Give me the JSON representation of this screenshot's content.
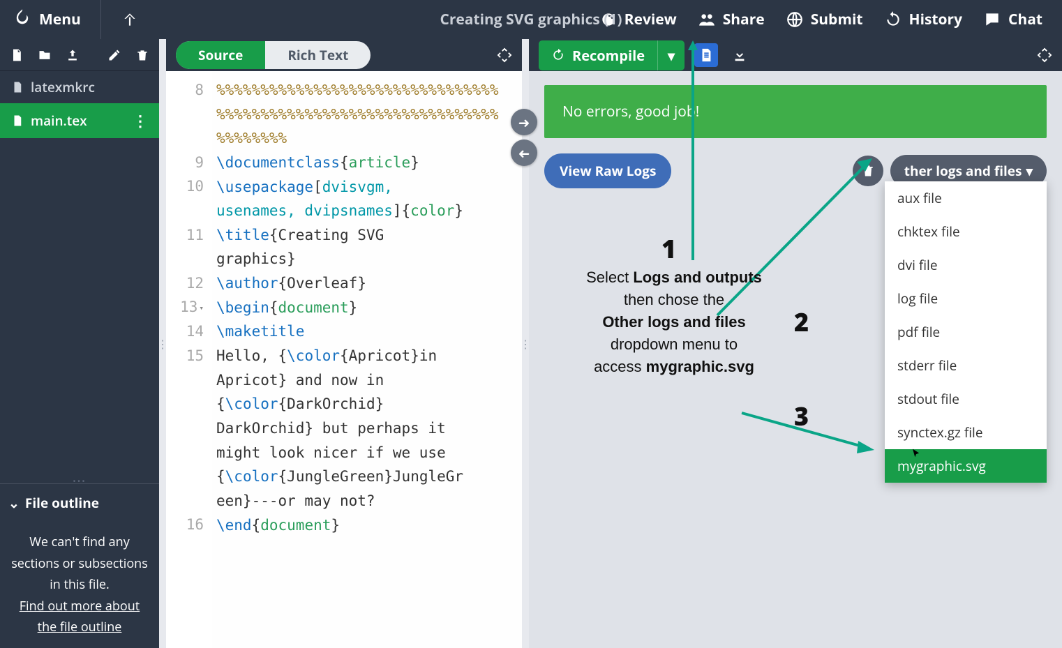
{
  "topbar": {
    "menu": "Menu",
    "title": "Creating SVG graphics (1)",
    "review": "Review",
    "share": "Share",
    "submit": "Submit",
    "history": "History",
    "chat": "Chat"
  },
  "files": {
    "f0": "latexmkrc",
    "f1": "main.tex"
  },
  "outline": {
    "head": "File outline",
    "body1": "We can't find any sections or subsections in this file.",
    "link": "Find out more about the file outline"
  },
  "editor": {
    "source": "Source",
    "rich": "Rich Text",
    "lines": {
      "8": "8",
      "9": "9",
      "10": "10",
      "11": "11",
      "12": "12",
      "13": "13",
      "14": "14",
      "15": "15",
      "16": "16"
    },
    "code": {
      "pct1": "%%%%%%%%%%%%%%%%%%%%%%%%%%%%%%%%",
      "pct2": "%%%%%%%%%%%%%%%%%%%%%%%%%%%%%%%%",
      "pct3": "%%%%%%%%",
      "dc_cmd": "\\documentclass",
      "dc_arg": "article",
      "up_cmd": "\\usepackage",
      "up_opt1": "dvisvgm,",
      "up_opt2": "usenames, dvipsnames",
      "up_arg": "color",
      "ti_cmd": "\\title",
      "ti_arg": "Creating SVG graphics",
      "au_cmd": "\\author",
      "au_arg": "Overleaf",
      "bg_cmd": "\\begin",
      "bg_arg": "document",
      "mk_cmd": "\\maketitle",
      "body1": "Hello, {",
      "col_cmd": "\\color",
      "col1": "Apricot",
      "body2": "in Apricot} and now in {",
      "col2": "DarkOrchid",
      "body3": "DarkOrchid} but perhaps it might look nicer if we use {",
      "col3": "JungleGreen",
      "body4": "JungleGreen}---or may not?",
      "en_cmd": "\\end",
      "en_arg": "document"
    }
  },
  "right": {
    "recompile": "Recompile",
    "noerr": "No errors, good job!",
    "rawlogs": "View Raw Logs",
    "other": "ther logs and files",
    "dropdown": {
      "d0": "aux file",
      "d1": "chktex file",
      "d2": "dvi file",
      "d3": "log file",
      "d4": "pdf file",
      "d5": "stderr file",
      "d6": "stdout file",
      "d7": "synctex.gz file",
      "d8": "mygraphic.svg"
    }
  },
  "anno": {
    "n1": "1",
    "n2": "2",
    "n3": "3",
    "t1a": "Select ",
    "t1b": "Logs and outputs",
    "t2a": "then chose the",
    "t3": "Other logs and files",
    "t4": "dropdown menu to",
    "t5a": "access ",
    "t5b": "mygraphic.svg"
  }
}
